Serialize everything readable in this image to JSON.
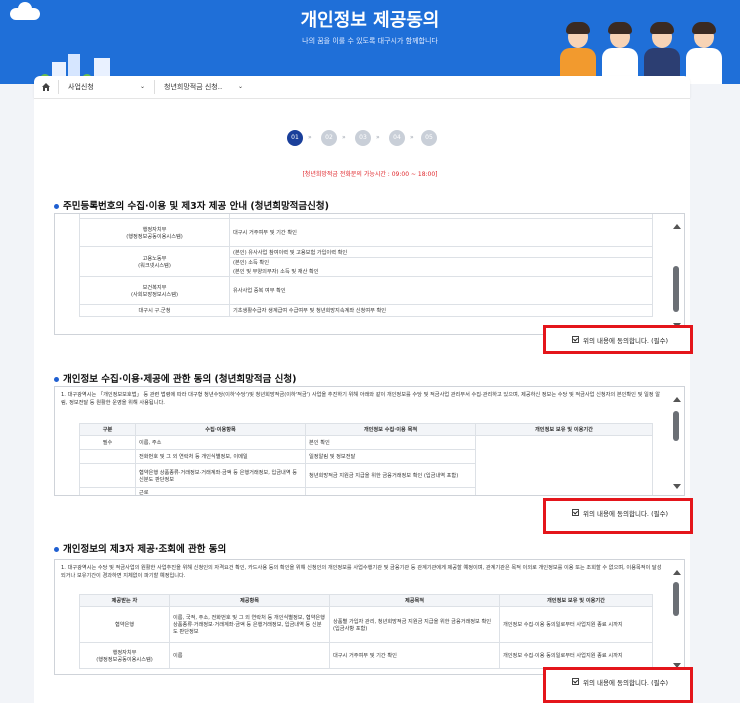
{
  "header": {
    "title": "개인정보 제공동의",
    "subtitle": "나의 꿈을 이룰 수 있도록 대구시가 함께합니다"
  },
  "nav": {
    "home_icon": "home-icon",
    "items": [
      {
        "label": "사업신청"
      },
      {
        "label": "청년희망적금 신청.."
      }
    ]
  },
  "steps": {
    "items": [
      "01",
      "02",
      "03",
      "04",
      "05"
    ],
    "active_index": 0,
    "arrow": "»"
  },
  "notice": "[청년희망적금 전화문의 가능시간 : 09:00 ~ 18:00]",
  "section1": {
    "title": "주민등록번호의 수집·이용 및 제3자 제공 안내 (청년희망적금신청)",
    "rows": [
      {
        "org": "행정자치부\n(행정정보공동이용시스템)",
        "content": [
          "대구시 거주여부 및 기간 확인"
        ]
      },
      {
        "org": "고용노동부\n(워크넷시스템)",
        "content": [
          "(본인) 유사사업 참여이력 및 고용보험 가입이력 확인",
          "(본인) 소득 확인",
          "(본인 및 부양의무자) 소득 및 재산 확인"
        ]
      },
      {
        "org": "보건복지부\n(사회보장정보시스템)",
        "content": [
          "유사사업 중복 여부 확인"
        ]
      },
      {
        "org": "대구시 구.군청",
        "content": [
          "기초생활수급자 생계급여 수급여부 및 청년희망지속계좌 신청여부 확인"
        ]
      }
    ],
    "agree_label": "위의 내용에 동의합니다. (필수)"
  },
  "section2": {
    "title": "개인정보 수집·이용·제공에 관한 동의 (청년희망적금 신청)",
    "intro": "1. 대구광역시는 「개인정보보호법」 등 관련 법령에 따라 대구형 청년수당(이하'수당')및 청년희망적금(이하'적금') 사업을 추진하기 위해 아래와 같이 개인정보를 수당 및 적금사업 관리부서 수집·관리하고 있으며, 제공하신 정보는 수당 및 적금사업 신청자의 본인확인 및 일정 알림, 정보전달 등 원활한 운영을 위해 사용됩니다.",
    "headers": [
      "구분",
      "수집·이용항목",
      "개인정보 수집·이용 목적",
      "개인정보 보유 및 이용기간"
    ],
    "rows": [
      {
        "kind": "필수",
        "item": "이름, 주소",
        "purpose": "본인 확인"
      },
      {
        "kind": "",
        "item": "전화번호 및 그 외 연락처 등 개인식별정보, 이메일",
        "purpose": "일정알림 및 정보전달"
      },
      {
        "kind": "",
        "item": "협약은행 상품종류·거래정보·거래계좌·금액 등 은행거래정보, 입금내역 등 신분도 판단정보",
        "purpose": "청년희망적금 지원금 지급을 위한 금융거래정보 확인 (입금내역 포함)"
      },
      {
        "kind": "",
        "item": "근로",
        "purpose": ""
      }
    ],
    "agree_label": "위의 내용에 동의합니다. (필수)"
  },
  "section3": {
    "title": "개인정보의 제3자 제공·조회에 관한 동의",
    "intro": "1. 대구광역시는 수당 및 적금사업의 원활한 사업추진을 위해 신청인의 자격요건 확인, 카드사용 등의 확인을 위해 신청인의 개인정보를 사업수행기관 및 금융기관 등 관계기관에게 제공할 예정이며, 관계기관은 목적 이외로 개인정보를 이용 또는 조회할 수 없으며, 이용목적이 달성되거나 보유기간이 경과하면 지체없이 파기할 예정입니다.",
    "headers": [
      "제공받는 자",
      "제공항목",
      "제공목적",
      "개인정보 보유 및 이용기간"
    ],
    "rows": [
      {
        "to": "협약은행",
        "items": "이름, 국적, 주소, 전화번호 및 그 외 연락처 등 개인식별정보, 협약은행 상품종류·거래정보·거래계좌·금액 등 은행거래정보, 입금내역 등 신분도 판단정보",
        "purpose": "상품별 가입자 관리, 청년희망적금 지원금 지급을 위한 금융거래정보 확인(입금사항 포함)",
        "period": "개인정보 수집·이용 동의일로부터 사업지원 종료 시까지"
      },
      {
        "to": "행정자치부\n(행정정보공동이용시스템)",
        "items": "이름",
        "purpose": "대구시 거주여부 및 기간 확인",
        "period": "개인정보 수집·이용 동의일로부터 사업지원 종료 시까지"
      }
    ],
    "agree_label": "위의 내용에 동의합니다. (필수)"
  },
  "colors": {
    "banner": "#1f6fd8",
    "active_step": "#1a3f9a",
    "notice": "#e0262b",
    "highlight_box": "#e4151b"
  }
}
